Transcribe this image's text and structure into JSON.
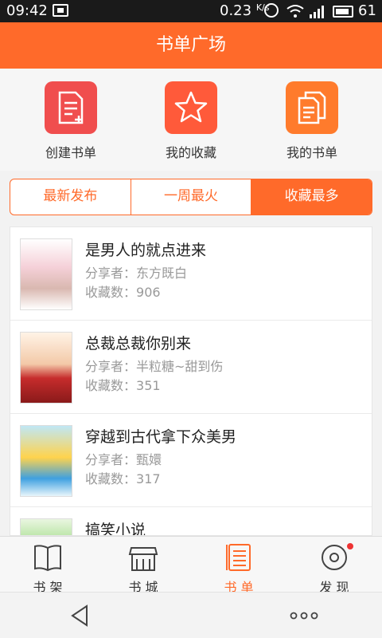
{
  "status": {
    "time": "09:42",
    "speed": "0.23",
    "speed_unit": "K/s",
    "battery": "61"
  },
  "header": {
    "title": "书单广场"
  },
  "actions": [
    {
      "label": "创建书单",
      "icon": "create-list-icon"
    },
    {
      "label": "我的收藏",
      "icon": "star-icon"
    },
    {
      "label": "我的书单",
      "icon": "my-lists-icon"
    }
  ],
  "tabs": [
    {
      "label": "最新发布",
      "active": false
    },
    {
      "label": "一周最火",
      "active": false
    },
    {
      "label": "收藏最多",
      "active": true
    }
  ],
  "books": [
    {
      "title": "是男人的就点进来",
      "sharer_label": "分享者：",
      "sharer": "东方既白",
      "fav_label": "收藏数：",
      "favs": "906"
    },
    {
      "title": "总裁总裁你别来",
      "sharer_label": "分享者：",
      "sharer": "半粒糖~甜到伤",
      "fav_label": "收藏数：",
      "favs": "351"
    },
    {
      "title": "穿越到古代拿下众美男",
      "sharer_label": "分享者：",
      "sharer": "甄嬛",
      "fav_label": "收藏数：",
      "favs": "317"
    },
    {
      "title": "搞笑小说"
    }
  ],
  "bottom_nav": [
    {
      "label": "书 架",
      "icon": "bookshelf-icon"
    },
    {
      "label": "书 城",
      "icon": "bookstore-icon"
    },
    {
      "label": "书 单",
      "icon": "booklist-icon",
      "active": true
    },
    {
      "label": "发 现",
      "icon": "discover-icon"
    }
  ],
  "colors": {
    "accent": "#ff6a2a",
    "status_bar": "#1a1a1a"
  }
}
